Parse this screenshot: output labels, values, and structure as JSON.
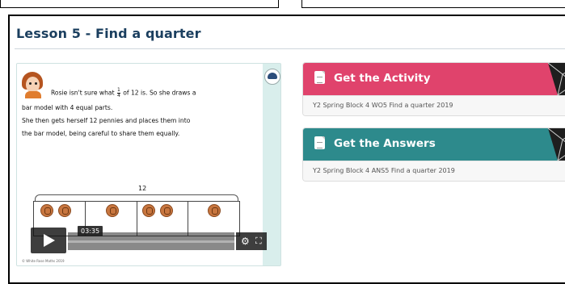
{
  "lesson": {
    "title": "Lesson 5 - Find a quarter"
  },
  "video": {
    "slide": {
      "line1_part1": "Rosie isn't sure what",
      "fraction_num": "1",
      "fraction_den": "4",
      "line1_part2": "of 12 is. So she draws a",
      "line2": "bar model with 4 equal parts.",
      "line3": "She then gets herself 12 pennies and places them into",
      "line4": "the bar model, being careful to share them equally.",
      "bar_total_label": "12",
      "copyright": "© White Rose Maths 2019"
    },
    "player": {
      "time_display": "03:35"
    }
  },
  "cards": {
    "activity": {
      "label": "Get the Activity",
      "file": "Y2 Spring Block 4 WO5 Find a quarter 2019",
      "color": "#e0436c"
    },
    "answers": {
      "label": "Get the Answers",
      "file": "Y2 Spring Block 4 ANS5 Find a quarter 2019",
      "color": "#2d8a8c"
    }
  }
}
